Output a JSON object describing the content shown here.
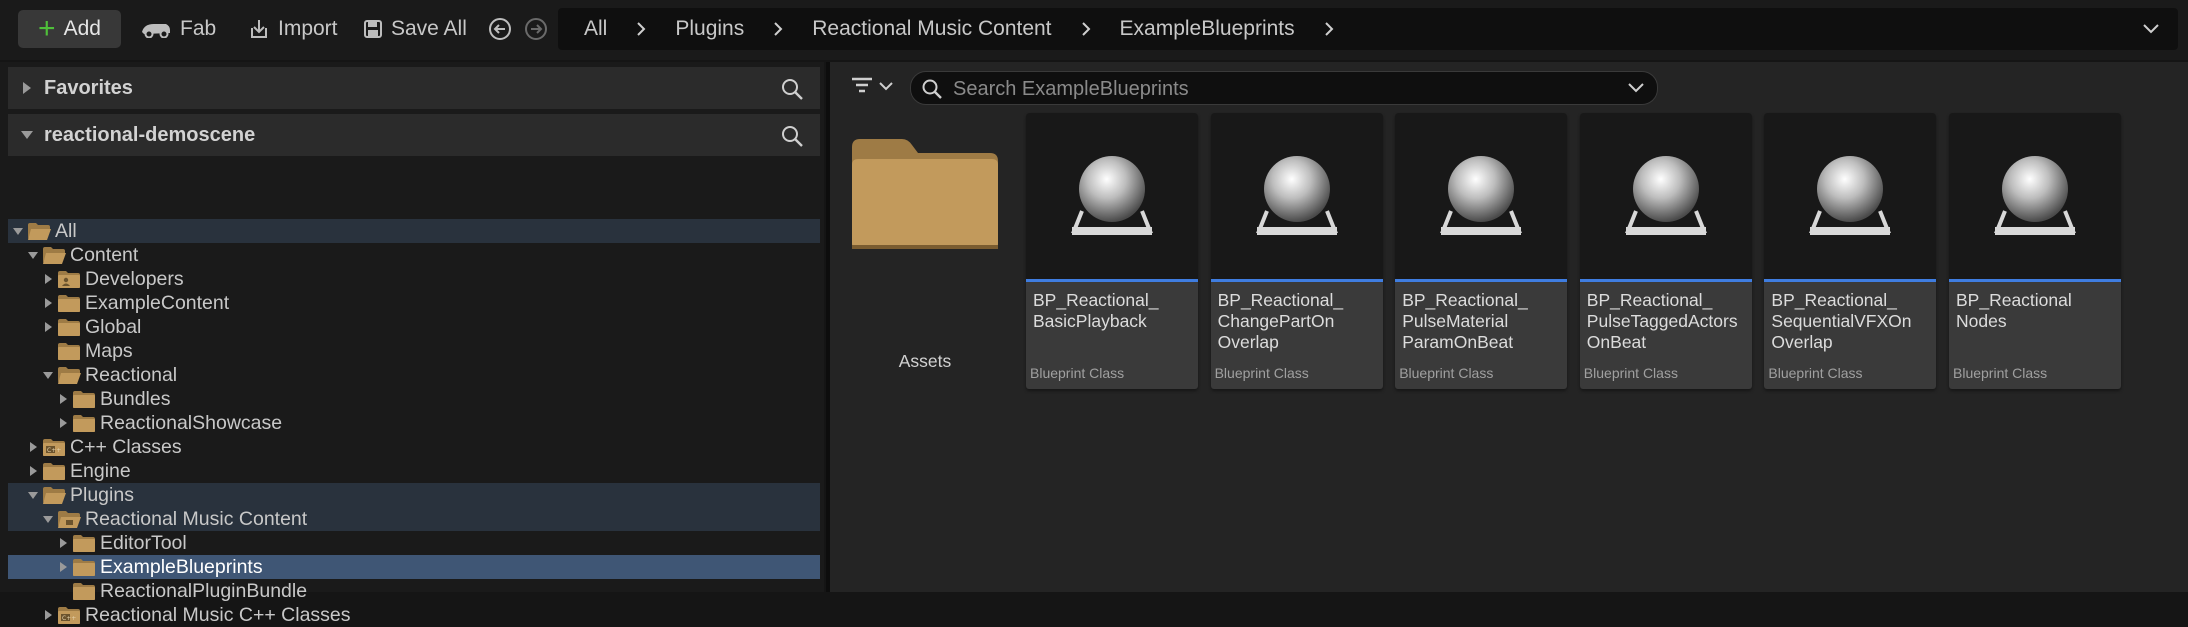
{
  "toolbar": {
    "add_label": "Add",
    "fab_label": "Fab",
    "import_label": "Import",
    "save_all_label": "Save All"
  },
  "breadcrumb": [
    "All",
    "Plugins",
    "Reactional Music Content",
    "ExampleBlueprints"
  ],
  "left_panel": {
    "favorites_label": "Favorites",
    "project_label": "reactional-demoscene",
    "tree": [
      {
        "label": "All",
        "depth": 0,
        "expanded": true,
        "has_children": true,
        "icon": "folder-open"
      },
      {
        "label": "Content",
        "depth": 1,
        "expanded": true,
        "has_children": true,
        "icon": "folder-open"
      },
      {
        "label": "Developers",
        "depth": 2,
        "expanded": false,
        "has_children": true,
        "icon": "folder-developer"
      },
      {
        "label": "ExampleContent",
        "depth": 2,
        "expanded": false,
        "has_children": true,
        "icon": "folder"
      },
      {
        "label": "Global",
        "depth": 2,
        "expanded": false,
        "has_children": true,
        "icon": "folder"
      },
      {
        "label": "Maps",
        "depth": 2,
        "expanded": false,
        "has_children": false,
        "icon": "folder"
      },
      {
        "label": "Reactional",
        "depth": 2,
        "expanded": true,
        "has_children": true,
        "icon": "folder-open"
      },
      {
        "label": "Bundles",
        "depth": 3,
        "expanded": false,
        "has_children": true,
        "icon": "folder"
      },
      {
        "label": "ReactionalShowcase",
        "depth": 3,
        "expanded": false,
        "has_children": true,
        "icon": "folder"
      },
      {
        "label": "C++ Classes",
        "depth": 1,
        "expanded": false,
        "has_children": true,
        "icon": "folder-cpp"
      },
      {
        "label": "Engine",
        "depth": 1,
        "expanded": false,
        "has_children": true,
        "icon": "folder"
      },
      {
        "label": "Plugins",
        "depth": 1,
        "expanded": true,
        "has_children": true,
        "icon": "folder-open"
      },
      {
        "label": "Reactional Music Content",
        "depth": 2,
        "expanded": true,
        "has_children": true,
        "icon": "folder-plugin-open"
      },
      {
        "label": "EditorTool",
        "depth": 3,
        "expanded": false,
        "has_children": true,
        "icon": "folder"
      },
      {
        "label": "ExampleBlueprints",
        "depth": 3,
        "expanded": false,
        "has_children": true,
        "icon": "folder"
      },
      {
        "label": "ReactionalPluginBundle",
        "depth": 3,
        "expanded": false,
        "has_children": false,
        "icon": "folder"
      },
      {
        "label": "Reactional Music C++ Classes",
        "depth": 2,
        "expanded": false,
        "has_children": true,
        "icon": "folder-cpp"
      }
    ]
  },
  "content_browser": {
    "search_placeholder": "Search ExampleBlueprints",
    "folder_label": "Assets",
    "assets": [
      {
        "name": "BP_Reactional_\nBasicPlayback",
        "type": "Blueprint Class"
      },
      {
        "name": "BP_Reactional_\nChangePartOn\nOverlap",
        "type": "Blueprint Class"
      },
      {
        "name": "BP_Reactional_\nPulseMaterial\nParamOnBeat",
        "type": "Blueprint Class"
      },
      {
        "name": "BP_Reactional_\nPulseTaggedActors\nOnBeat",
        "type": "Blueprint Class"
      },
      {
        "name": "BP_Reactional_\nSequentialVFXOn\nOverlap",
        "type": "Blueprint Class"
      },
      {
        "name": "BP_Reactional\nNodes",
        "type": "Blueprint Class"
      }
    ]
  },
  "colors": {
    "accent_blue": "#3f7de0",
    "selection": "#3f5675",
    "folder": "#c29a5c",
    "add_green": "#4fbf3a"
  }
}
